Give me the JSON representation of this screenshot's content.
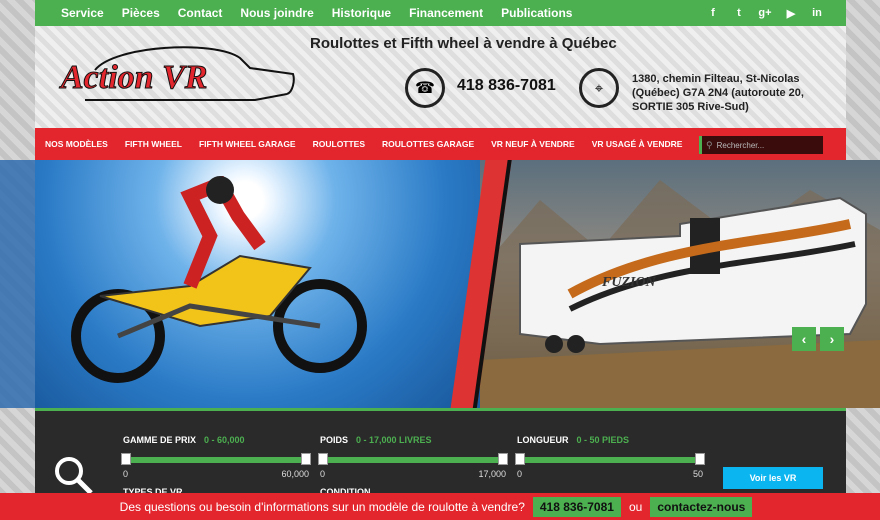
{
  "topnav": {
    "links": [
      "Service",
      "Pièces",
      "Contact",
      "Nous joindre",
      "Historique",
      "Financement",
      "Publications"
    ],
    "social": [
      "f",
      "t",
      "g+",
      "yt",
      "in"
    ]
  },
  "header": {
    "logo_text": "Action VR",
    "tagline": "Roulottes et Fifth wheel à vendre à Québec",
    "phone": "418 836-7081",
    "address": "1380, chemin Filteau, St-Nicolas (Québec) G7A 2N4 (autoroute 20, SORTIE 305 Rive-Sud)"
  },
  "rednav": {
    "items": [
      "NOS MODÈLES",
      "FIFTH WHEEL",
      "FIFTH WHEEL GARAGE",
      "ROULOTTES",
      "ROULOTTES GARAGE",
      "VR NEUF À VENDRE",
      "VR USAGÉ À VENDRE"
    ],
    "search_placeholder": "Rechercher..."
  },
  "hero": {
    "trailer_brand": "FUZION"
  },
  "filters": {
    "prix": {
      "label": "GAMME DE PRIX",
      "value": "0 - 60,000",
      "min": "0",
      "max": "60,000"
    },
    "poids": {
      "label": "POIDS",
      "value": "0 - 17,000 LIVRES",
      "min": "0",
      "max": "17,000"
    },
    "longueur": {
      "label": "LONGUEUR",
      "value": "0 - 50 PIEDS",
      "min": "0",
      "max": "50"
    },
    "types_label": "TYPES DE VR",
    "condition_label": "CONDITION",
    "submit": "Voir les VR"
  },
  "bottombar": {
    "text": "Des questions ou besoin d'informations sur un modèle de roulotte à vendre?",
    "phone": "418 836-7081",
    "or": "ou",
    "contact": "contactez-nous"
  },
  "colors": {
    "green": "#4caf50",
    "red": "#e3262e",
    "blue_button": "#0bb5f0"
  }
}
